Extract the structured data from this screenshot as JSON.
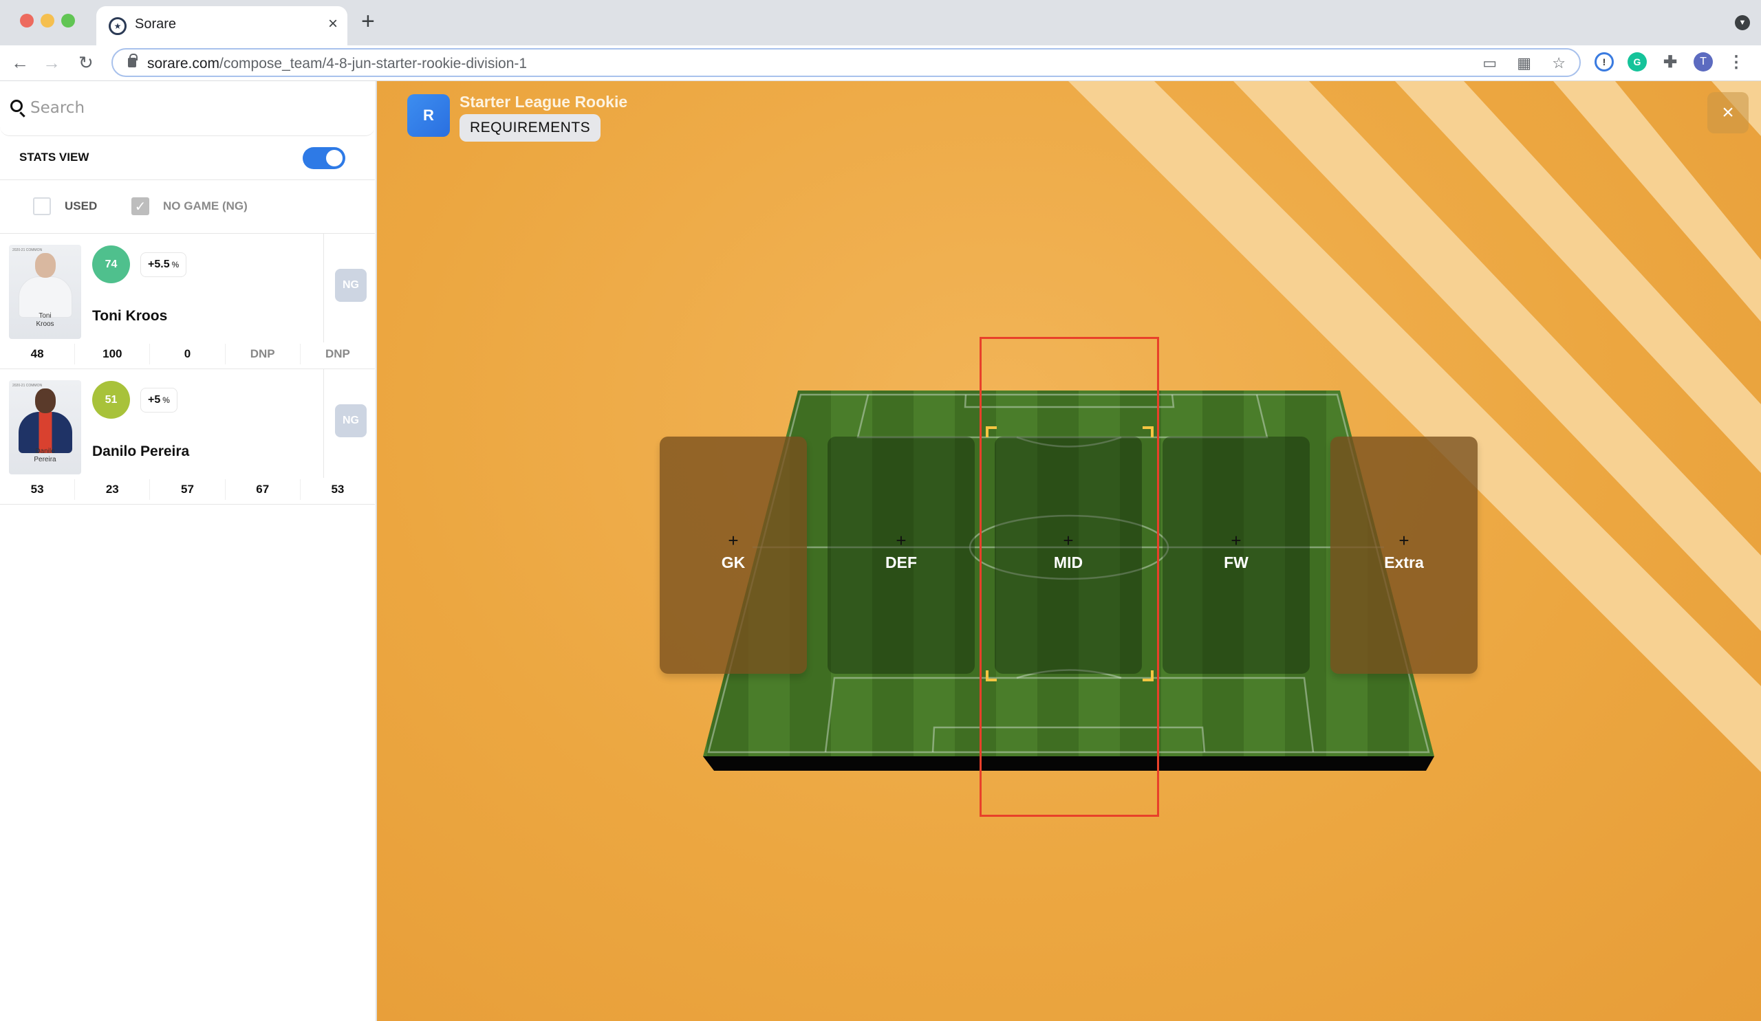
{
  "browser": {
    "tab_title": "Sorare",
    "url_host": "sorare.com",
    "url_path": "/compose_team/4-8-jun-starter-rookie-division-1",
    "profile_initial": "T"
  },
  "sidebar": {
    "search_placeholder": "Search",
    "stats_view_label": "STATS VIEW",
    "stats_view_on": true,
    "filters": [
      {
        "label": "USED",
        "checked": false
      },
      {
        "label": "NO GAME (NG)",
        "checked": true
      }
    ],
    "players": [
      {
        "name": "Toni Kroos",
        "card_name_line1": "Toni",
        "card_name_line2": "Kroos",
        "card_season": "2020-21 COMMON",
        "score": "74",
        "score_color": "#4fc08d",
        "bonus": "+5.5",
        "bonus_unit": "%",
        "status_badge": "NG",
        "stats": [
          "48",
          "100",
          "0",
          "DNP",
          "DNP"
        ]
      },
      {
        "name": "Danilo Pereira",
        "card_name_line1": "Danilo",
        "card_name_line2": "Pereira",
        "card_season": "2020-21 COMMON",
        "score": "51",
        "score_color": "#a8c23a",
        "bonus": "+5",
        "bonus_unit": "%",
        "status_badge": "NG",
        "stats": [
          "53",
          "23",
          "57",
          "67",
          "53"
        ]
      }
    ]
  },
  "main": {
    "league_icon_letter": "R",
    "league_title": "Starter League Rookie",
    "requirements_label": "REQUIREMENTS",
    "close_label": "×",
    "slots": [
      {
        "label": "GK",
        "plus": "+"
      },
      {
        "label": "DEF",
        "plus": "+"
      },
      {
        "label": "MID",
        "plus": "+"
      },
      {
        "label": "FW",
        "plus": "+"
      },
      {
        "label": "Extra",
        "plus": "+"
      }
    ]
  },
  "colors": {
    "accent_blue": "#2e7ae6",
    "background_orange": "#eca741",
    "highlight_red": "#e8402a",
    "bracket_yellow": "#f4c542"
  }
}
